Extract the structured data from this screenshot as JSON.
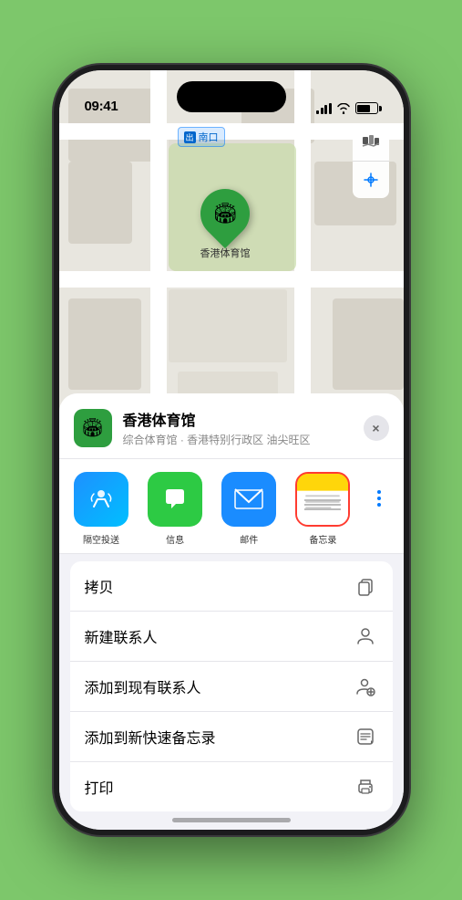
{
  "status_bar": {
    "time": "09:41",
    "arrow_label": "▲"
  },
  "map": {
    "label": "南口",
    "label_prefix": "出"
  },
  "location_card": {
    "name": "香港体育馆",
    "subtitle": "综合体育馆 · 香港特别行政区 油尖旺区",
    "close_label": "×"
  },
  "share_items": [
    {
      "id": "airdrop",
      "label": "隔空投送",
      "type": "airdrop"
    },
    {
      "id": "messages",
      "label": "信息",
      "type": "messages"
    },
    {
      "id": "mail",
      "label": "邮件",
      "type": "mail"
    },
    {
      "id": "notes",
      "label": "备忘录",
      "type": "notes",
      "selected": true
    }
  ],
  "action_items": [
    {
      "label": "拷贝",
      "icon": "copy"
    },
    {
      "label": "新建联系人",
      "icon": "person"
    },
    {
      "label": "添加到现有联系人",
      "icon": "person-add"
    },
    {
      "label": "添加到新快速备忘录",
      "icon": "note"
    },
    {
      "label": "打印",
      "icon": "print"
    }
  ],
  "map_pin_label": "香港体育馆"
}
